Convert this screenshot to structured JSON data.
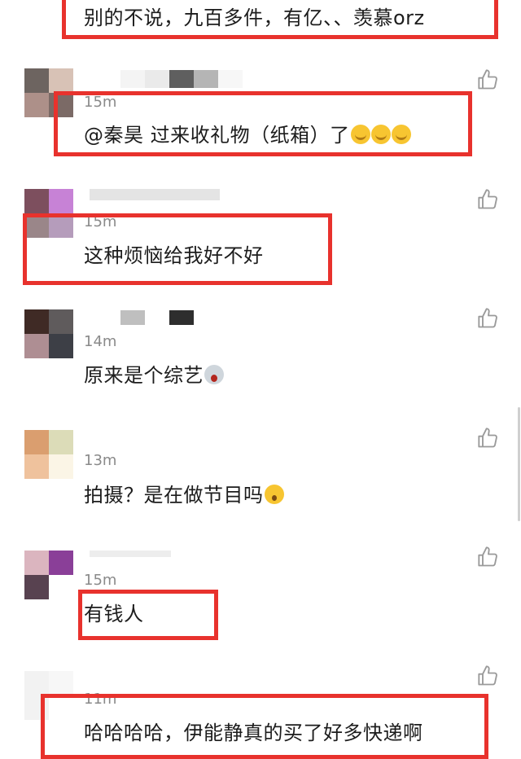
{
  "comments": [
    {
      "text": "别的不说，九百多件，有亿、、羡慕orz"
    },
    {
      "time": "15m",
      "text": "@秦昊 过来收礼物（纸箱）了",
      "emoji": "laughing-emoji"
    },
    {
      "time": "15m",
      "text": "这种烦恼给我好不好"
    },
    {
      "time": "14m",
      "text": "原来是个综艺",
      "emoji": "screaming-emoji"
    },
    {
      "time": "13m",
      "text": "拍摄？是在做节目吗",
      "emoji": "astonished-emoji"
    },
    {
      "time": "15m",
      "text": "有钱人"
    },
    {
      "time": "11m",
      "text": "哈哈哈哈，伊能静真的买了好多快递啊"
    }
  ],
  "colors": {
    "highlight_border": "#e8322d",
    "time_text": "#8a8a8a",
    "like_icon": "#9a9a9a"
  },
  "icons": {
    "like": "thumbs-up-icon"
  }
}
